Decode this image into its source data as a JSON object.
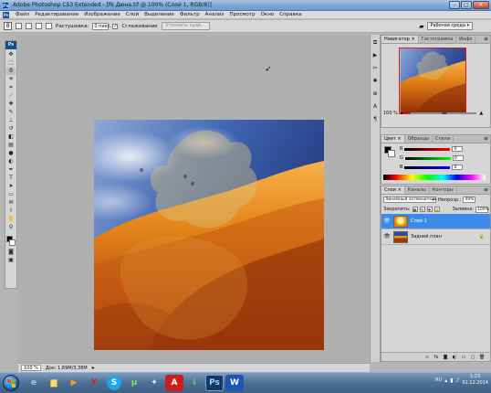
{
  "window": {
    "title": "Adobe Photoshop CS3 Extended - [f6 Дюна.tif @ 100% (Слой 1, RGB/8)]",
    "minimize": "–",
    "maximize": "□",
    "close": "✕"
  },
  "menu": [
    "Файл",
    "Редактирование",
    "Изображение",
    "Слой",
    "Выделение",
    "Фильтр",
    "Анализ",
    "Просмотр",
    "Окно",
    "Справка"
  ],
  "options": {
    "feather_label": "Растушевка:",
    "feather_value": "0 пикс.",
    "antialias_label": "Сглаживание",
    "refine_label": "Уточнить край...",
    "workspace_label": "Рабочая среда ▾"
  },
  "statusbar": {
    "zoom": "100 %",
    "doc": "Док: 1,69M/3,38M"
  },
  "navigator": {
    "tabs": [
      "Навигатор ×",
      "Гистограмма",
      "Инфо"
    ],
    "zoom": "100 %"
  },
  "color_panel": {
    "tabs": [
      "Цвет ×",
      "Образцы",
      "Стили"
    ],
    "channels": [
      {
        "label": "R",
        "value": "0"
      },
      {
        "label": "G",
        "value": "0"
      },
      {
        "label": "B",
        "value": "0"
      }
    ]
  },
  "layers_panel": {
    "tabs": [
      "Слои ×",
      "Каналы",
      "Контуры"
    ],
    "blend_mode": "Линейный затемнитель",
    "opacity_label": "Непрозр.:",
    "opacity_value": "40%",
    "lock_label": "Закрепить:",
    "fill_label": "Заливка:",
    "fill_value": "100%",
    "layers": [
      {
        "name": "Слой 1",
        "active": true
      },
      {
        "name": "Задний план",
        "active": false
      }
    ]
  },
  "taskbar": {
    "language": "RU",
    "time": "1:23",
    "date": "02.12.2014"
  },
  "colors": {
    "accent": "#3d8be8",
    "canvas_sky": "#2f4f9c",
    "canvas_dune": "#e58a1c"
  }
}
